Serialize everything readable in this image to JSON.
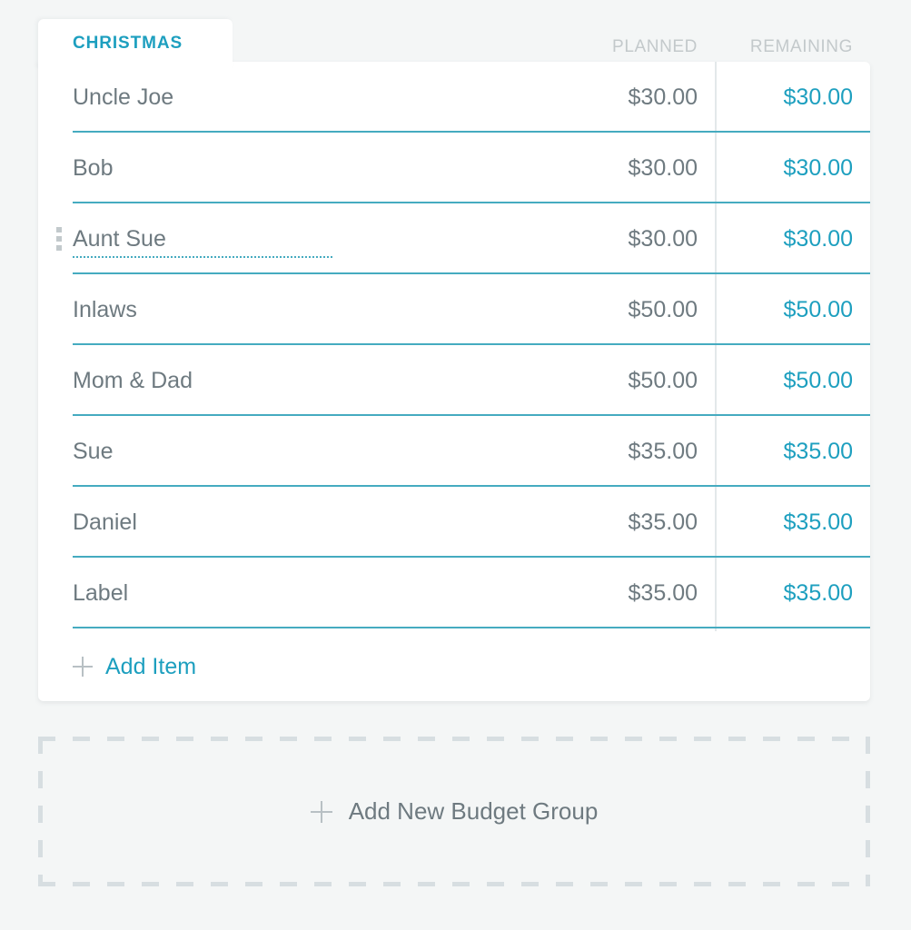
{
  "colors": {
    "accent_teal": "#1d9fbf",
    "separator_teal": "#45abc0",
    "label_gray": "#6e7a80",
    "header_gray": "#c3c9cb",
    "page_background": "#f4f6f6",
    "card_background": "#ffffff",
    "dashed_border": "#d7dee1"
  },
  "group": {
    "tab_title": "CHRISTMAS",
    "columns": {
      "planned": "PLANNED",
      "remaining": "REMAINING"
    },
    "items": [
      {
        "label": "Uncle Joe",
        "planned": "$30.00",
        "remaining": "$30.00",
        "editing": false
      },
      {
        "label": "Bob",
        "planned": "$30.00",
        "remaining": "$30.00",
        "editing": false
      },
      {
        "label": "Aunt Sue",
        "planned": "$30.00",
        "remaining": "$30.00",
        "editing": true
      },
      {
        "label": "Inlaws",
        "planned": "$50.00",
        "remaining": "$50.00",
        "editing": false
      },
      {
        "label": "Mom & Dad",
        "planned": "$50.00",
        "remaining": "$50.00",
        "editing": false
      },
      {
        "label": "Sue",
        "planned": "$35.00",
        "remaining": "$35.00",
        "editing": false
      },
      {
        "label": "Daniel",
        "planned": "$35.00",
        "remaining": "$35.00",
        "editing": false
      },
      {
        "label": "Label",
        "planned": "$35.00",
        "remaining": "$35.00",
        "editing": false
      }
    ],
    "add_item": {
      "label": "Add Item",
      "icon": "plus-icon"
    }
  },
  "add_group": {
    "label": "Add New Budget Group",
    "icon": "plus-icon"
  }
}
